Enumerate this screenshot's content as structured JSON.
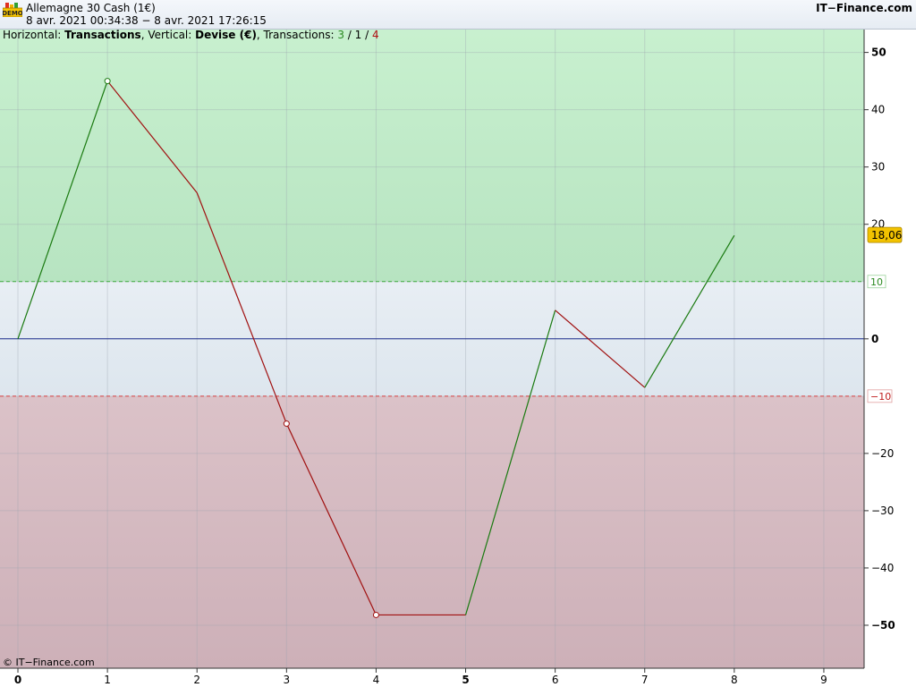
{
  "header": {
    "title": "Allemagne 30 Cash (1€)",
    "date_range": "8 avr. 2021 00:34:38 − 8 avr. 2021 17:26:15",
    "brand": "IT−Finance.com",
    "demo_badge": "DEMO"
  },
  "subtitle": {
    "horizontal_label": "Horizontal: ",
    "horizontal_value": "Transactions",
    "vertical_label": ", Vertical: ",
    "vertical_value": "Devise (€)",
    "transactions_label": ", Transactions: ",
    "count_green": "3",
    "sep1": " / ",
    "count_neutral": "1",
    "sep2": " / ",
    "count_red": "4"
  },
  "copyright": "© IT−Finance.com",
  "colors": {
    "profit_zone": "#bfe9c8",
    "neutral_zone": "#e3ebf2",
    "loss_zone": "#d3b7bf",
    "up_line": "#1a7a10",
    "down_line": "#a01010",
    "zero_line": "#1a2a8a",
    "last_value_badge": "#f2c200"
  },
  "chart_data": {
    "type": "line",
    "title": "",
    "xlabel": "Transactions",
    "ylabel": "Devise (€)",
    "x": [
      0,
      1,
      2,
      3,
      4,
      5,
      6,
      7,
      8
    ],
    "values": [
      0,
      45,
      25.5,
      -14.8,
      -48.2,
      -48.2,
      5,
      -8.5,
      18.06
    ],
    "xlim": [
      -0.2,
      9.45
    ],
    "ylim": [
      -57.5,
      54
    ],
    "x_ticks": [
      "0",
      "1",
      "2",
      "3",
      "4",
      "5",
      "6",
      "7",
      "8",
      "9"
    ],
    "y_ticks": [
      "50",
      "40",
      "30",
      "20",
      "0",
      "−20",
      "−30",
      "−40",
      "−50"
    ],
    "y_tick_values": [
      50,
      40,
      30,
      20,
      0,
      -20,
      -30,
      -40,
      -50
    ],
    "upper_threshold": {
      "value": 10,
      "label": "10"
    },
    "lower_threshold": {
      "value": -10,
      "label": "−10"
    },
    "last_value": {
      "value": 18.06,
      "label": "18,06"
    },
    "marked_points": [
      1,
      3,
      4
    ],
    "grid": true
  }
}
